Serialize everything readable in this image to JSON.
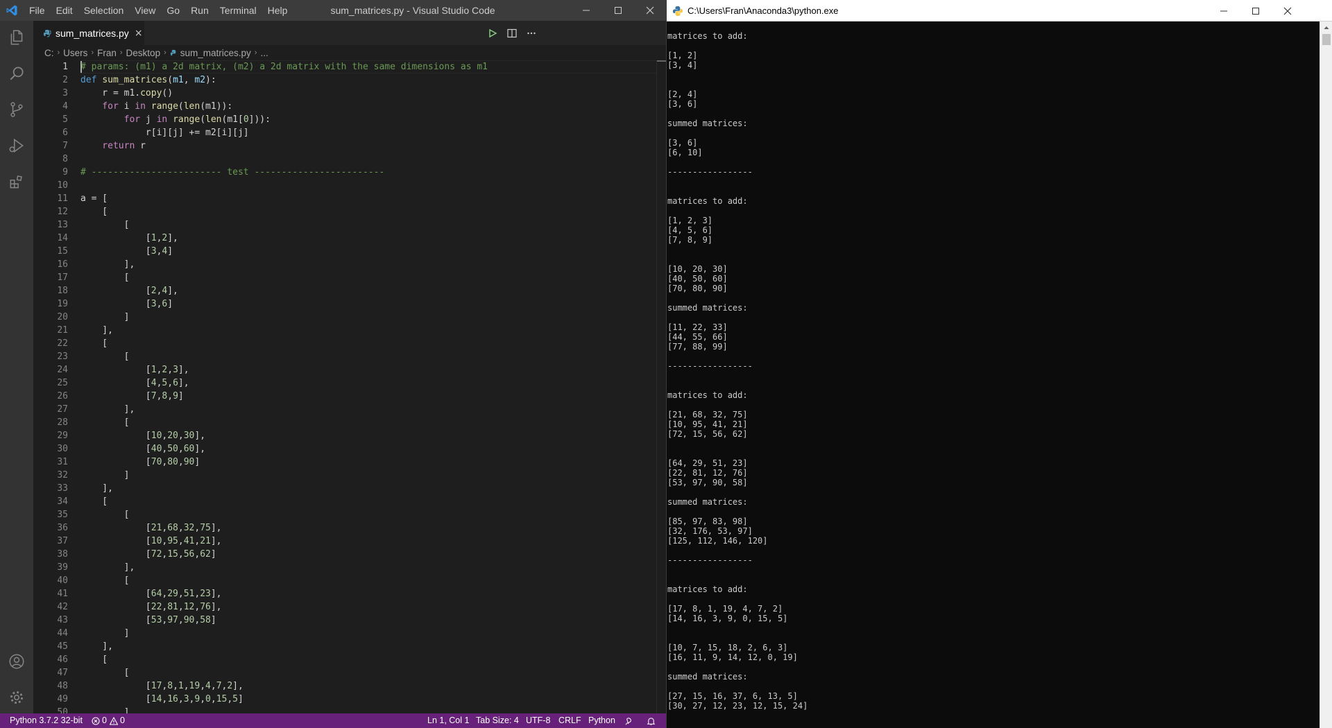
{
  "vscode": {
    "menu": [
      "File",
      "Edit",
      "Selection",
      "View",
      "Go",
      "Run",
      "Terminal",
      "Help"
    ],
    "window_title": "sum_matrices.py - Visual Studio Code",
    "tab": {
      "filename": "sum_matrices.py",
      "close": "×"
    },
    "breadcrumb": [
      "C:",
      "Users",
      "Fran",
      "Desktop",
      "sum_matrices.py",
      "..."
    ],
    "line_numbers": [
      "1",
      "2",
      "3",
      "4",
      "5",
      "6",
      "7",
      "8",
      "9",
      "10",
      "11",
      "12",
      "13",
      "14",
      "15",
      "16",
      "17",
      "18",
      "19",
      "20",
      "21",
      "22",
      "23",
      "24",
      "25",
      "26",
      "27",
      "28",
      "29",
      "30",
      "31",
      "32",
      "33",
      "34",
      "35",
      "36",
      "37",
      "38",
      "39",
      "40",
      "41",
      "42",
      "43",
      "44",
      "45",
      "46",
      "47",
      "48",
      "49",
      "50"
    ],
    "code_lines": [
      [
        [
          "cm",
          "# params: (m1) a 2d matrix, (m2) a 2d matrix with the same dimensions as m1"
        ]
      ],
      [
        [
          "kw",
          "def "
        ],
        [
          "fn",
          "sum_matrices"
        ],
        [
          "",
          "("
        ],
        [
          "pm",
          "m1"
        ],
        [
          "",
          ", "
        ],
        [
          "pm",
          "m2"
        ],
        [
          "",
          "):"
        ]
      ],
      [
        [
          "",
          "    r = m1."
        ],
        [
          "fn",
          "copy"
        ],
        [
          "",
          "()"
        ]
      ],
      [
        [
          "kf",
          "    for"
        ],
        [
          "",
          " i "
        ],
        [
          "kf",
          "in"
        ],
        [
          "",
          " "
        ],
        [
          "fn",
          "range"
        ],
        [
          "",
          "("
        ],
        [
          "fn",
          "len"
        ],
        [
          "",
          "(m1)):"
        ]
      ],
      [
        [
          "kf",
          "        for"
        ],
        [
          "",
          " j "
        ],
        [
          "kf",
          "in"
        ],
        [
          "",
          " "
        ],
        [
          "fn",
          "range"
        ],
        [
          "",
          "("
        ],
        [
          "fn",
          "len"
        ],
        [
          "",
          "(m1["
        ],
        [
          "nm",
          "0"
        ],
        [
          "",
          "])):"
        ]
      ],
      [
        [
          "",
          "            r[i][j] += m2[i][j]"
        ]
      ],
      [
        [
          "kf",
          "    return"
        ],
        [
          "",
          " r"
        ]
      ],
      [
        [
          "",
          ""
        ]
      ],
      [
        [
          "cm",
          "# ------------------------ test ------------------------"
        ]
      ],
      [
        [
          "",
          ""
        ]
      ],
      [
        [
          "",
          "a = ["
        ]
      ],
      [
        [
          "",
          "    ["
        ]
      ],
      [
        [
          "",
          "        ["
        ]
      ],
      [
        [
          "",
          "            ["
        ],
        [
          "nm",
          "1"
        ],
        [
          "",
          ","
        ],
        [
          "nm",
          "2"
        ],
        [
          "",
          "],"
        ]
      ],
      [
        [
          "",
          "            ["
        ],
        [
          "nm",
          "3"
        ],
        [
          "",
          ","
        ],
        [
          "nm",
          "4"
        ],
        [
          "",
          "]"
        ]
      ],
      [
        [
          "",
          "        ],"
        ]
      ],
      [
        [
          "",
          "        ["
        ]
      ],
      [
        [
          "",
          "            ["
        ],
        [
          "nm",
          "2"
        ],
        [
          "",
          ","
        ],
        [
          "nm",
          "4"
        ],
        [
          "",
          "],"
        ]
      ],
      [
        [
          "",
          "            ["
        ],
        [
          "nm",
          "3"
        ],
        [
          "",
          ","
        ],
        [
          "nm",
          "6"
        ],
        [
          "",
          "]"
        ]
      ],
      [
        [
          "",
          "        ]"
        ]
      ],
      [
        [
          "",
          "    ],"
        ]
      ],
      [
        [
          "",
          "    ["
        ]
      ],
      [
        [
          "",
          "        ["
        ]
      ],
      [
        [
          "",
          "            ["
        ],
        [
          "nm",
          "1"
        ],
        [
          "",
          ","
        ],
        [
          "nm",
          "2"
        ],
        [
          "",
          ","
        ],
        [
          "nm",
          "3"
        ],
        [
          "",
          "],"
        ]
      ],
      [
        [
          "",
          "            ["
        ],
        [
          "nm",
          "4"
        ],
        [
          "",
          ","
        ],
        [
          "nm",
          "5"
        ],
        [
          "",
          ","
        ],
        [
          "nm",
          "6"
        ],
        [
          "",
          "],"
        ]
      ],
      [
        [
          "",
          "            ["
        ],
        [
          "nm",
          "7"
        ],
        [
          "",
          ","
        ],
        [
          "nm",
          "8"
        ],
        [
          "",
          ","
        ],
        [
          "nm",
          "9"
        ],
        [
          "",
          "]"
        ]
      ],
      [
        [
          "",
          "        ],"
        ]
      ],
      [
        [
          "",
          "        ["
        ]
      ],
      [
        [
          "",
          "            ["
        ],
        [
          "nm",
          "10"
        ],
        [
          "",
          ","
        ],
        [
          "nm",
          "20"
        ],
        [
          "",
          ","
        ],
        [
          "nm",
          "30"
        ],
        [
          "",
          "],"
        ]
      ],
      [
        [
          "",
          "            ["
        ],
        [
          "nm",
          "40"
        ],
        [
          "",
          ","
        ],
        [
          "nm",
          "50"
        ],
        [
          "",
          ","
        ],
        [
          "nm",
          "60"
        ],
        [
          "",
          "],"
        ]
      ],
      [
        [
          "",
          "            ["
        ],
        [
          "nm",
          "70"
        ],
        [
          "",
          ","
        ],
        [
          "nm",
          "80"
        ],
        [
          "",
          ","
        ],
        [
          "nm",
          "90"
        ],
        [
          "",
          "]"
        ]
      ],
      [
        [
          "",
          "        ]"
        ]
      ],
      [
        [
          "",
          "    ],"
        ]
      ],
      [
        [
          "",
          "    ["
        ]
      ],
      [
        [
          "",
          "        ["
        ]
      ],
      [
        [
          "",
          "            ["
        ],
        [
          "nm",
          "21"
        ],
        [
          "",
          ","
        ],
        [
          "nm",
          "68"
        ],
        [
          "",
          ","
        ],
        [
          "nm",
          "32"
        ],
        [
          "",
          ","
        ],
        [
          "nm",
          "75"
        ],
        [
          "",
          "],"
        ]
      ],
      [
        [
          "",
          "            ["
        ],
        [
          "nm",
          "10"
        ],
        [
          "",
          ","
        ],
        [
          "nm",
          "95"
        ],
        [
          "",
          ","
        ],
        [
          "nm",
          "41"
        ],
        [
          "",
          ","
        ],
        [
          "nm",
          "21"
        ],
        [
          "",
          "],"
        ]
      ],
      [
        [
          "",
          "            ["
        ],
        [
          "nm",
          "72"
        ],
        [
          "",
          ","
        ],
        [
          "nm",
          "15"
        ],
        [
          "",
          ","
        ],
        [
          "nm",
          "56"
        ],
        [
          "",
          ","
        ],
        [
          "nm",
          "62"
        ],
        [
          "",
          "]"
        ]
      ],
      [
        [
          "",
          "        ],"
        ]
      ],
      [
        [
          "",
          "        ["
        ]
      ],
      [
        [
          "",
          "            ["
        ],
        [
          "nm",
          "64"
        ],
        [
          "",
          ","
        ],
        [
          "nm",
          "29"
        ],
        [
          "",
          ","
        ],
        [
          "nm",
          "51"
        ],
        [
          "",
          ","
        ],
        [
          "nm",
          "23"
        ],
        [
          "",
          "],"
        ]
      ],
      [
        [
          "",
          "            ["
        ],
        [
          "nm",
          "22"
        ],
        [
          "",
          ","
        ],
        [
          "nm",
          "81"
        ],
        [
          "",
          ","
        ],
        [
          "nm",
          "12"
        ],
        [
          "",
          ","
        ],
        [
          "nm",
          "76"
        ],
        [
          "",
          "],"
        ]
      ],
      [
        [
          "",
          "            ["
        ],
        [
          "nm",
          "53"
        ],
        [
          "",
          ","
        ],
        [
          "nm",
          "97"
        ],
        [
          "",
          ","
        ],
        [
          "nm",
          "90"
        ],
        [
          "",
          ","
        ],
        [
          "nm",
          "58"
        ],
        [
          "",
          "]"
        ]
      ],
      [
        [
          "",
          "        ]"
        ]
      ],
      [
        [
          "",
          "    ],"
        ]
      ],
      [
        [
          "",
          "    ["
        ]
      ],
      [
        [
          "",
          "        ["
        ]
      ],
      [
        [
          "",
          "            ["
        ],
        [
          "nm",
          "17"
        ],
        [
          "",
          ","
        ],
        [
          "nm",
          "8"
        ],
        [
          "",
          ","
        ],
        [
          "nm",
          "1"
        ],
        [
          "",
          ","
        ],
        [
          "nm",
          "19"
        ],
        [
          "",
          ","
        ],
        [
          "nm",
          "4"
        ],
        [
          "",
          ","
        ],
        [
          "nm",
          "7"
        ],
        [
          "",
          ","
        ],
        [
          "nm",
          "2"
        ],
        [
          "",
          "],"
        ]
      ],
      [
        [
          "",
          "            ["
        ],
        [
          "nm",
          "14"
        ],
        [
          "",
          ","
        ],
        [
          "nm",
          "16"
        ],
        [
          "",
          ","
        ],
        [
          "nm",
          "3"
        ],
        [
          "",
          ","
        ],
        [
          "nm",
          "9"
        ],
        [
          "",
          ","
        ],
        [
          "nm",
          "0"
        ],
        [
          "",
          ","
        ],
        [
          "nm",
          "15"
        ],
        [
          "",
          ","
        ],
        [
          "nm",
          "5"
        ],
        [
          "",
          "]"
        ]
      ],
      [
        [
          "",
          "        ]"
        ]
      ]
    ],
    "status": {
      "interpreter": "Python 3.7.2 32-bit",
      "errors": "0",
      "warnings": "0",
      "position": "Ln 1, Col 1",
      "tab_size": "Tab Size: 4",
      "encoding": "UTF-8",
      "eol": "CRLF",
      "language": "Python"
    }
  },
  "console": {
    "title": "C:\\Users\\Fran\\Anaconda3\\python.exe",
    "lines": [
      "",
      "matrices to add:",
      "",
      "[1, 2]",
      "[3, 4]",
      "",
      "",
      "[2, 4]",
      "[3, 6]",
      "",
      "summed matrices:",
      "",
      "[3, 6]",
      "[6, 10]",
      "",
      "-----------------",
      "",
      "",
      "matrices to add:",
      "",
      "[1, 2, 3]",
      "[4, 5, 6]",
      "[7, 8, 9]",
      "",
      "",
      "[10, 20, 30]",
      "[40, 50, 60]",
      "[70, 80, 90]",
      "",
      "summed matrices:",
      "",
      "[11, 22, 33]",
      "[44, 55, 66]",
      "[77, 88, 99]",
      "",
      "-----------------",
      "",
      "",
      "matrices to add:",
      "",
      "[21, 68, 32, 75]",
      "[10, 95, 41, 21]",
      "[72, 15, 56, 62]",
      "",
      "",
      "[64, 29, 51, 23]",
      "[22, 81, 12, 76]",
      "[53, 97, 90, 58]",
      "",
      "summed matrices:",
      "",
      "[85, 97, 83, 98]",
      "[32, 176, 53, 97]",
      "[125, 112, 146, 120]",
      "",
      "-----------------",
      "",
      "",
      "matrices to add:",
      "",
      "[17, 8, 1, 19, 4, 7, 2]",
      "[14, 16, 3, 9, 0, 15, 5]",
      "",
      "",
      "[10, 7, 15, 18, 2, 6, 3]",
      "[16, 11, 9, 14, 12, 0, 19]",
      "",
      "summed matrices:",
      "",
      "[27, 15, 16, 37, 6, 13, 5]",
      "[30, 27, 12, 23, 12, 15, 24]"
    ]
  }
}
